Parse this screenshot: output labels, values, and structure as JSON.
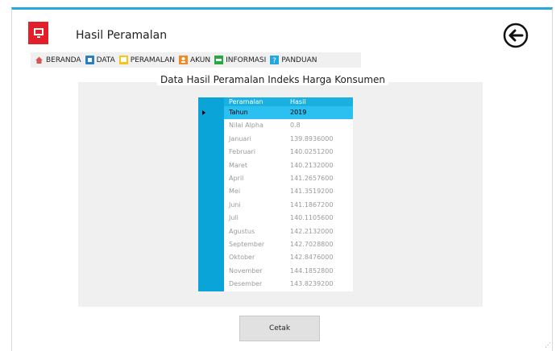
{
  "app": {
    "title": "Hasil Peramalan"
  },
  "menu": [
    {
      "label": "BERANDA",
      "icon": "home-icon",
      "color": "#d9534f"
    },
    {
      "label": "DATA",
      "icon": "database-icon",
      "color": "#2a7fc0"
    },
    {
      "label": "PERAMALAN",
      "icon": "chart-icon",
      "color": "#f5c518"
    },
    {
      "label": "AKUN",
      "icon": "user-icon",
      "color": "#f08a24"
    },
    {
      "label": "INFORMASI",
      "icon": "info-icon",
      "color": "#27a844"
    },
    {
      "label": "PANDUAN",
      "icon": "help-icon",
      "color": "#22a7e0"
    }
  ],
  "groupbox": {
    "title": "Data Hasil Peramalan Indeks Harga Konsumen"
  },
  "grid": {
    "columns": [
      "Peramalan",
      "Hasil"
    ],
    "rows": [
      {
        "label": "Tahun",
        "value": "2019"
      },
      {
        "label": "Nilai Alpha",
        "value": "0.8"
      },
      {
        "label": "Januari",
        "value": "139.8936000"
      },
      {
        "label": "Februari",
        "value": "140.0251200"
      },
      {
        "label": "Maret",
        "value": "140.2132000"
      },
      {
        "label": "April",
        "value": "141.2657600"
      },
      {
        "label": "Mei",
        "value": "141.3519200"
      },
      {
        "label": "Juni",
        "value": "141.1867200"
      },
      {
        "label": "Juli",
        "value": "140.1105600"
      },
      {
        "label": "Agustus",
        "value": "142.2132000"
      },
      {
        "label": "September",
        "value": "142.7028800"
      },
      {
        "label": "Oktober",
        "value": "142.8476000"
      },
      {
        "label": "November",
        "value": "144.1852800"
      },
      {
        "label": "Desember",
        "value": "143.8239200"
      }
    ]
  },
  "actions": {
    "print_label": "Cetak"
  },
  "colors": {
    "accent": "#29a9d9",
    "app_icon": "#e3202a",
    "grid_header": "#1ab0e0",
    "grid_selected": "#2bc0f0"
  }
}
